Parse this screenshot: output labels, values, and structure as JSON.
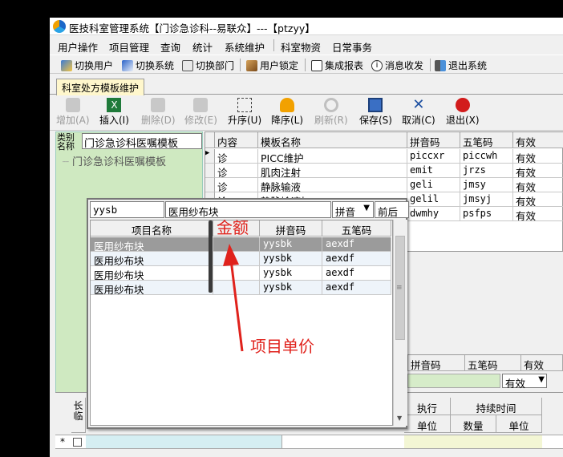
{
  "window": {
    "title": "医技科室管理系统【门诊急诊科--易联众】---【ptzyy】"
  },
  "menu": [
    "用户操作",
    "项目管理",
    "查询",
    "统计",
    "系统维护",
    "科室物资",
    "日常事务"
  ],
  "quickbar": [
    "切换用户",
    "切换系统",
    "切换部门",
    "用户锁定",
    "集成报表",
    "消息收发",
    "退出系统"
  ],
  "tab": {
    "label": "科室处方模板维护"
  },
  "toolbar": {
    "add": "增加(A)",
    "insert": "插入(I)",
    "delete": "删除(D)",
    "modify": "修改(E)",
    "asc": "升序(U)",
    "desc": "降序(L)",
    "refresh": "刷新(R)",
    "save": "保存(S)",
    "cancel": "取消(C)",
    "exit": "退出(X)"
  },
  "left": {
    "category_label_1": "类别",
    "category_label_2": "名称",
    "category_value": "门诊急诊科医嘱模板",
    "tree_node": "门诊急诊科医嘱模板"
  },
  "grid": {
    "headers": [
      "内容",
      "模板名称",
      "拼音码",
      "五笔码",
      "有效"
    ],
    "rows": [
      {
        "content": "诊",
        "name": "PICC维护",
        "pinyin": "piccxr",
        "wubi": "piccwh",
        "valid": "有效"
      },
      {
        "content": "诊",
        "name": "肌肉注射",
        "pinyin": "emit",
        "wubi": "jrzs",
        "valid": "有效"
      },
      {
        "content": "诊",
        "name": "静脉输液",
        "pinyin": "geli",
        "wubi": "jmsy",
        "valid": "有效"
      },
      {
        "content": "诊",
        "name": "静脉输液加",
        "pinyin": "gelil",
        "wubi": "jmsyj",
        "valid": "有效"
      },
      {
        "content": "诊",
        "name": "",
        "pinyin": "dwmhy",
        "wubi": "psfps",
        "valid": "有效"
      }
    ]
  },
  "sub": {
    "pinyin": "拼音码",
    "wubi": "五笔码",
    "valid": "有效",
    "valid_select": "有效"
  },
  "bottom": {
    "long_label": "长",
    "long_label2": "临",
    "exec_label": "执行",
    "exec_unit": "单位",
    "duration_label": "持续时间",
    "duration_qty": "数量",
    "duration_unit": "单位"
  },
  "popup": {
    "code_input": "yysb",
    "name_input": "医用纱布块",
    "mode": "拼音",
    "match": "前后",
    "headers": [
      "项目名称",
      "",
      "拼音码",
      "五笔码"
    ],
    "rows": [
      {
        "name": "医用纱布块",
        "price": "",
        "pinyin": "yysbk",
        "wubi": "aexdf"
      },
      {
        "name": "医用纱布块",
        "price": "",
        "pinyin": "yysbk",
        "wubi": "aexdf"
      },
      {
        "name": "医用纱布块",
        "price": "",
        "pinyin": "yysbk",
        "wubi": "aexdf"
      },
      {
        "name": "医用纱布块",
        "price": "",
        "pinyin": "yysbk",
        "wubi": "aexdf"
      }
    ]
  },
  "annotations": {
    "amount": "金额",
    "unit_price": "项目单价"
  },
  "colors": {
    "annotation": "#e0221c",
    "tab_bg": "#fff7cc",
    "left_panel": "#cfe9c1",
    "selected_row": "#9b9b9b"
  }
}
